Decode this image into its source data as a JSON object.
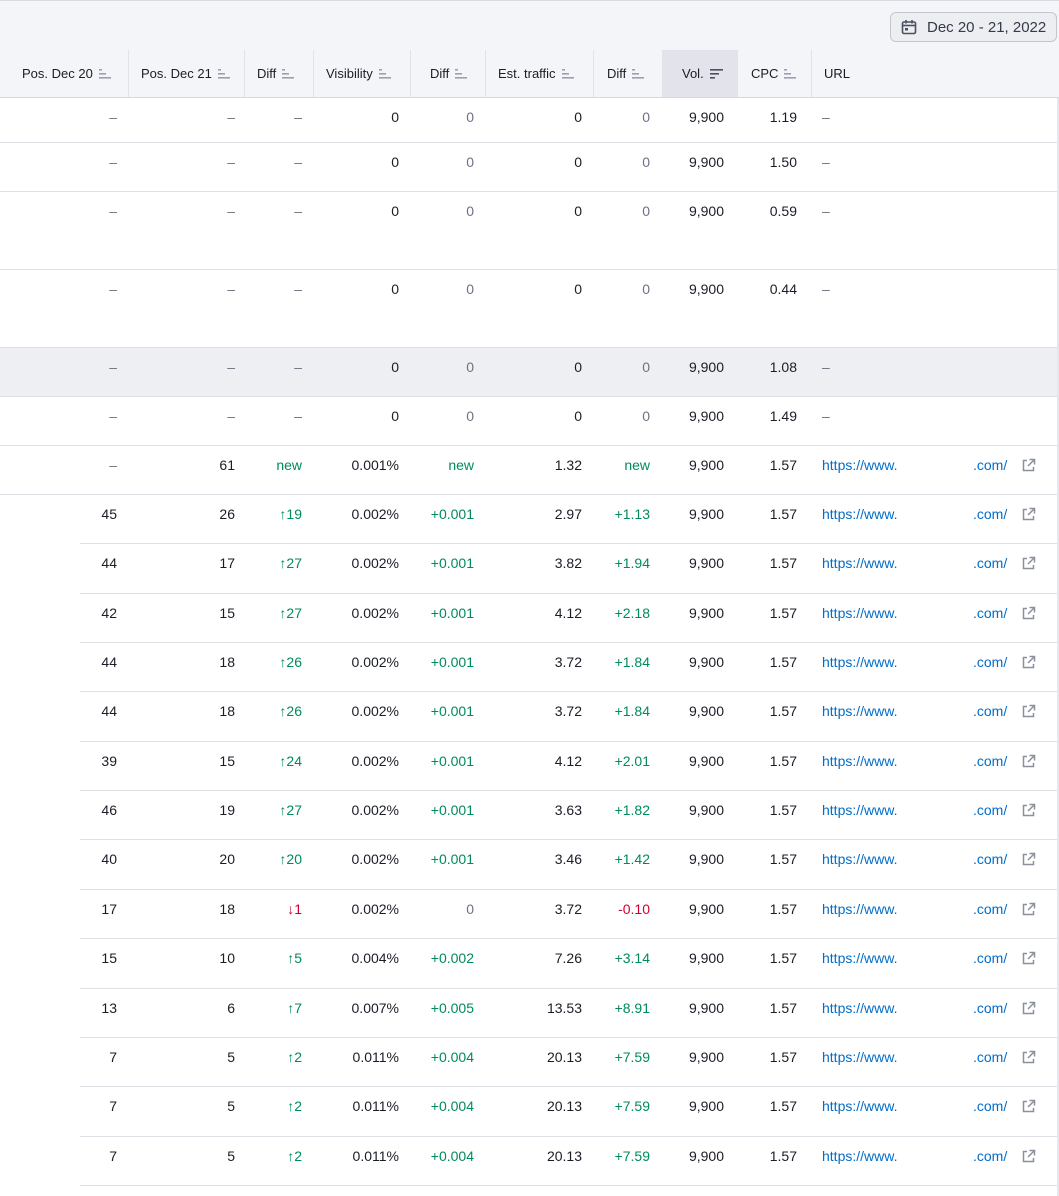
{
  "date_range": "Dec 20 - 21, 2022",
  "columns": [
    "Pos. Dec 20",
    "Pos. Dec 21",
    "Diff",
    "Visibility",
    "Diff",
    "Est. traffic",
    "Diff",
    "Vol.",
    "CPC",
    "URL"
  ],
  "rows": [
    {
      "pos20": "–",
      "pos21": "–",
      "diff": "–",
      "vis": "0",
      "visdiff": "0",
      "traffic": "0",
      "trdiff": "0",
      "vol": "9,900",
      "cpc": "1.19",
      "url1": "–",
      "url2": ""
    },
    {
      "pos20": "–",
      "pos21": "–",
      "diff": "–",
      "vis": "0",
      "visdiff": "0",
      "traffic": "0",
      "trdiff": "0",
      "vol": "9,900",
      "cpc": "1.50",
      "url1": "–",
      "url2": ""
    },
    {
      "pos20": "–",
      "pos21": "–",
      "diff": "–",
      "vis": "0",
      "visdiff": "0",
      "traffic": "0",
      "trdiff": "0",
      "vol": "9,900",
      "cpc": "0.59",
      "url1": "–",
      "url2": ""
    },
    {
      "pos20": "–",
      "pos21": "–",
      "diff": "–",
      "vis": "0",
      "visdiff": "0",
      "traffic": "0",
      "trdiff": "0",
      "vol": "9,900",
      "cpc": "0.44",
      "url1": "–",
      "url2": ""
    },
    {
      "pos20": "–",
      "pos21": "–",
      "diff": "–",
      "vis": "0",
      "visdiff": "0",
      "traffic": "0",
      "trdiff": "0",
      "vol": "9,900",
      "cpc": "1.08",
      "url1": "–",
      "url2": "",
      "highlight": true
    },
    {
      "pos20": "–",
      "pos21": "–",
      "diff": "–",
      "vis": "0",
      "visdiff": "0",
      "traffic": "0",
      "trdiff": "0",
      "vol": "9,900",
      "cpc": "1.49",
      "url1": "–",
      "url2": ""
    },
    {
      "pos20": "–",
      "pos21": "61",
      "diff": "new",
      "vis": "0.001%",
      "visdiff": "new",
      "traffic": "1.32",
      "trdiff": "new",
      "vol": "9,900",
      "cpc": "1.57",
      "url1": "https://www.",
      "url2": ".com/"
    },
    {
      "pos20": "45",
      "pos21": "26",
      "diff": "↑19",
      "vis": "0.002%",
      "visdiff": "+0.001",
      "traffic": "2.97",
      "trdiff": "+1.13",
      "vol": "9,900",
      "cpc": "1.57",
      "url1": "https://www.",
      "url2": ".com/"
    },
    {
      "pos20": "44",
      "pos21": "17",
      "diff": "↑27",
      "vis": "0.002%",
      "visdiff": "+0.001",
      "traffic": "3.82",
      "trdiff": "+1.94",
      "vol": "9,900",
      "cpc": "1.57",
      "url1": "https://www.",
      "url2": ".com/"
    },
    {
      "pos20": "42",
      "pos21": "15",
      "diff": "↑27",
      "vis": "0.002%",
      "visdiff": "+0.001",
      "traffic": "4.12",
      "trdiff": "+2.18",
      "vol": "9,900",
      "cpc": "1.57",
      "url1": "https://www.",
      "url2": ".com/"
    },
    {
      "pos20": "44",
      "pos21": "18",
      "diff": "↑26",
      "vis": "0.002%",
      "visdiff": "+0.001",
      "traffic": "3.72",
      "trdiff": "+1.84",
      "vol": "9,900",
      "cpc": "1.57",
      "url1": "https://www.",
      "url2": ".com/"
    },
    {
      "pos20": "44",
      "pos21": "18",
      "diff": "↑26",
      "vis": "0.002%",
      "visdiff": "+0.001",
      "traffic": "3.72",
      "trdiff": "+1.84",
      "vol": "9,900",
      "cpc": "1.57",
      "url1": "https://www.",
      "url2": ".com/"
    },
    {
      "pos20": "39",
      "pos21": "15",
      "diff": "↑24",
      "vis": "0.002%",
      "visdiff": "+0.001",
      "traffic": "4.12",
      "trdiff": "+2.01",
      "vol": "9,900",
      "cpc": "1.57",
      "url1": "https://www.",
      "url2": ".com/"
    },
    {
      "pos20": "46",
      "pos21": "19",
      "diff": "↑27",
      "vis": "0.002%",
      "visdiff": "+0.001",
      "traffic": "3.63",
      "trdiff": "+1.82",
      "vol": "9,900",
      "cpc": "1.57",
      "url1": "https://www.",
      "url2": ".com/"
    },
    {
      "pos20": "40",
      "pos21": "20",
      "diff": "↑20",
      "vis": "0.002%",
      "visdiff": "+0.001",
      "traffic": "3.46",
      "trdiff": "+1.42",
      "vol": "9,900",
      "cpc": "1.57",
      "url1": "https://www.",
      "url2": ".com/"
    },
    {
      "pos20": "17",
      "pos21": "18",
      "diff": "↓1",
      "vis": "0.002%",
      "visdiff": "0",
      "traffic": "3.72",
      "trdiff": "-0.10",
      "vol": "9,900",
      "cpc": "1.57",
      "url1": "https://www.",
      "url2": ".com/"
    },
    {
      "pos20": "15",
      "pos21": "10",
      "diff": "↑5",
      "vis": "0.004%",
      "visdiff": "+0.002",
      "traffic": "7.26",
      "trdiff": "+3.14",
      "vol": "9,900",
      "cpc": "1.57",
      "url1": "https://www.",
      "url2": ".com/"
    },
    {
      "pos20": "13",
      "pos21": "6",
      "diff": "↑7",
      "vis": "0.007%",
      "visdiff": "+0.005",
      "traffic": "13.53",
      "trdiff": "+8.91",
      "vol": "9,900",
      "cpc": "1.57",
      "url1": "https://www.",
      "url2": ".com/"
    },
    {
      "pos20": "7",
      "pos21": "5",
      "diff": "↑2",
      "vis": "0.011%",
      "visdiff": "+0.004",
      "traffic": "20.13",
      "trdiff": "+7.59",
      "vol": "9,900",
      "cpc": "1.57",
      "url1": "https://www.",
      "url2": ".com/"
    },
    {
      "pos20": "7",
      "pos21": "5",
      "diff": "↑2",
      "vis": "0.011%",
      "visdiff": "+0.004",
      "traffic": "20.13",
      "trdiff": "+7.59",
      "vol": "9,900",
      "cpc": "1.57",
      "url1": "https://www.",
      "url2": ".com/"
    },
    {
      "pos20": "7",
      "pos21": "5",
      "diff": "↑2",
      "vis": "0.011%",
      "visdiff": "+0.004",
      "traffic": "20.13",
      "trdiff": "+7.59",
      "vol": "9,900",
      "cpc": "1.57",
      "url1": "https://www.",
      "url2": ".com/"
    }
  ],
  "colors": {
    "positive": "#008a5e",
    "negative": "#d1002f",
    "link": "#006dca"
  },
  "icons": {
    "date_button": "calendar-icon",
    "column_sort": "sort-icon",
    "url": "external-link-icon"
  }
}
